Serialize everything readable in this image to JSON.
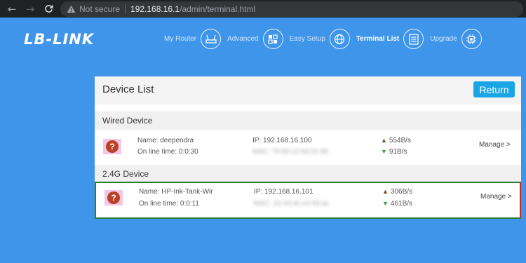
{
  "browser": {
    "security_label": "Not secure",
    "url_host": "192.168.16.1",
    "url_path": "/admin/terminal.html"
  },
  "brand": {
    "logo_text": "LB-LINK"
  },
  "nav": [
    {
      "label": "My Router",
      "icon": "router-icon"
    },
    {
      "label": "Advanced",
      "icon": "advanced-icon"
    },
    {
      "label": "Easy Setup",
      "icon": "globe-icon"
    },
    {
      "label": "Terminal List",
      "icon": "list-icon",
      "active": true
    },
    {
      "label": "Upgrade",
      "icon": "chip-icon"
    }
  ],
  "panel": {
    "title": "Device List",
    "return_label": "Return"
  },
  "sections": {
    "wired": {
      "title": "Wired Device",
      "device": {
        "name": "Name: deependra",
        "online_time": "On line time: 0:0:30",
        "ip": "IP: 192.168.16.100",
        "mac": "MAC: 70:85:c2:6d:31:89",
        "upload": "554B/s",
        "download": "91B/s",
        "manage": "Manage >"
      }
    },
    "wireless_24g": {
      "title": "2.4G Device",
      "device": {
        "name": "Name: HP-Ink-Tank-Wir",
        "online_time": "On line time: 0:0:11",
        "ip": "IP: 192.168.16.101",
        "mac": "MAC: 22:43:dc:e2:93:ac",
        "upload": "306B/s",
        "download": "461B/s",
        "manage": "Manage >"
      }
    }
  },
  "colors": {
    "page_bg": "#3f95ea",
    "return_button": "#1aa6e6",
    "unknown_device_icon": "#b84127"
  }
}
